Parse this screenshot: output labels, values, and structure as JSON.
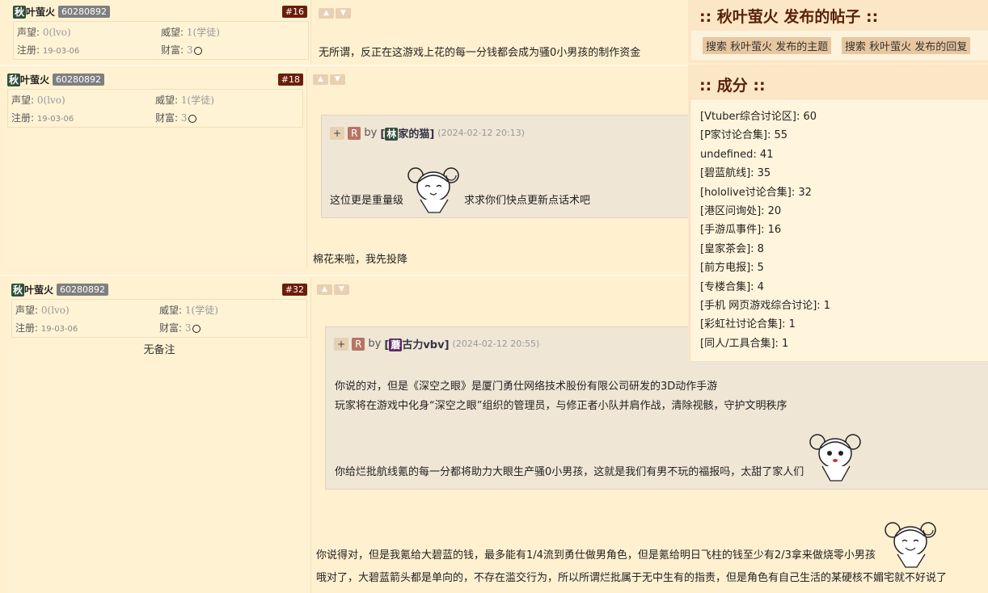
{
  "posts": [
    {
      "author": {
        "avatar_char": "秋",
        "name": "叶萤火",
        "uid": "60280892"
      },
      "floor": "#16",
      "stats": {
        "fame_label": "声望:",
        "fame_value": "0(lvo)",
        "prestige_label": "威望:",
        "prestige_value": "1(学徒)",
        "reg_label": "注册:",
        "reg_value": "19-03-06",
        "wealth_label": "财富:",
        "wealth_value": "3"
      },
      "body": [
        "无所谓，反正在这游戏上花的每一分钱都会成为骚0小男孩的制作资金"
      ]
    },
    {
      "author": {
        "avatar_char": "秋",
        "name": "叶萤火",
        "uid": "60280892"
      },
      "floor": "#18",
      "stats": {
        "fame_label": "声望:",
        "fame_value": "0(lvo)",
        "prestige_label": "威望:",
        "prestige_value": "1(学徒)",
        "reg_label": "注册:",
        "reg_value": "19-03-06",
        "wealth_label": "财富:",
        "wealth_value": "3"
      },
      "quote": {
        "plus": "+",
        "r": "R",
        "by": "by",
        "author_char": "林",
        "author_name": "家的猫",
        "date": "(2024-02-12 20:13)",
        "text_before": "这位更是重量级",
        "text_after": "求求你们快点更新点话术吧"
      },
      "body": [
        "棉花来啦，我先投降"
      ]
    },
    {
      "author": {
        "avatar_char": "秋",
        "name": "叶萤火",
        "uid": "60280892"
      },
      "floor": "#32",
      "stats": {
        "fame_label": "声望:",
        "fame_value": "0(lvo)",
        "prestige_label": "威望:",
        "prestige_value": "1(学徒)",
        "reg_label": "注册:",
        "reg_value": "19-03-06",
        "wealth_label": "财富:",
        "wealth_value": "3"
      },
      "remark": "无备注",
      "quote": {
        "plus": "+",
        "r": "R",
        "by": "by",
        "author_char": "蘑",
        "author_name": "古力vbv",
        "date": "(2024-02-12 20:55)",
        "lines": [
          "你说的对，但是《深空之眼》是厦门勇仕网络技术股份有限公司研发的3D动作手游",
          "玩家将在游戏中化身“深空之眼”组织的管理员，与修正者小队并肩作战，清除视骸，守护文明秩序",
          "你给烂批航线氪的每一分都将助力大眼生产骚0小男孩，这就是我们有男不玩的福报吗，太甜了家人们"
        ]
      },
      "body": [
        "你说得对，但是我氪给大碧蓝的钱，最多能有1/4流到勇仕做男角色，但是氪给明日飞柱的钱至少有2/3拿来做烧零小男孩",
        "哦对了，大碧蓝箭头都是单向的，不存在滥交行为，所以所谓烂批属于无中生有的指责，但是角色有自己生活的某硬核不媚宅就不好说了"
      ]
    }
  ],
  "sidebar": {
    "posts_title": ":: 秋叶萤火 发布的帖子 ::",
    "search_topics": "搜索 秋叶萤火 发布的主题",
    "search_replies": "搜索 秋叶萤火 发布的回复",
    "score_title": ":: 成分 ::",
    "scores": [
      "[Vtuber综合讨论区]: 60",
      "[P家讨论合集]: 55",
      "undefined: 41",
      "[碧蓝航线]: 35",
      "[hololive讨论合集]: 32",
      "[港区问询处]: 20",
      "[手游瓜事件]: 16",
      "[皇家茶会]: 8",
      "[前方电报]: 5",
      "[专楼合集]: 4",
      "[手机 网页游戏综合讨论]: 1",
      "[彩虹社讨论合集]: 1",
      "[同人/工具合集]: 1"
    ]
  },
  "icons": {
    "vote_up": "thumbs-up-icon",
    "vote_down": "thumbs-down-icon",
    "coin": "coin-icon",
    "sticker": "anime-girl-sticker"
  }
}
